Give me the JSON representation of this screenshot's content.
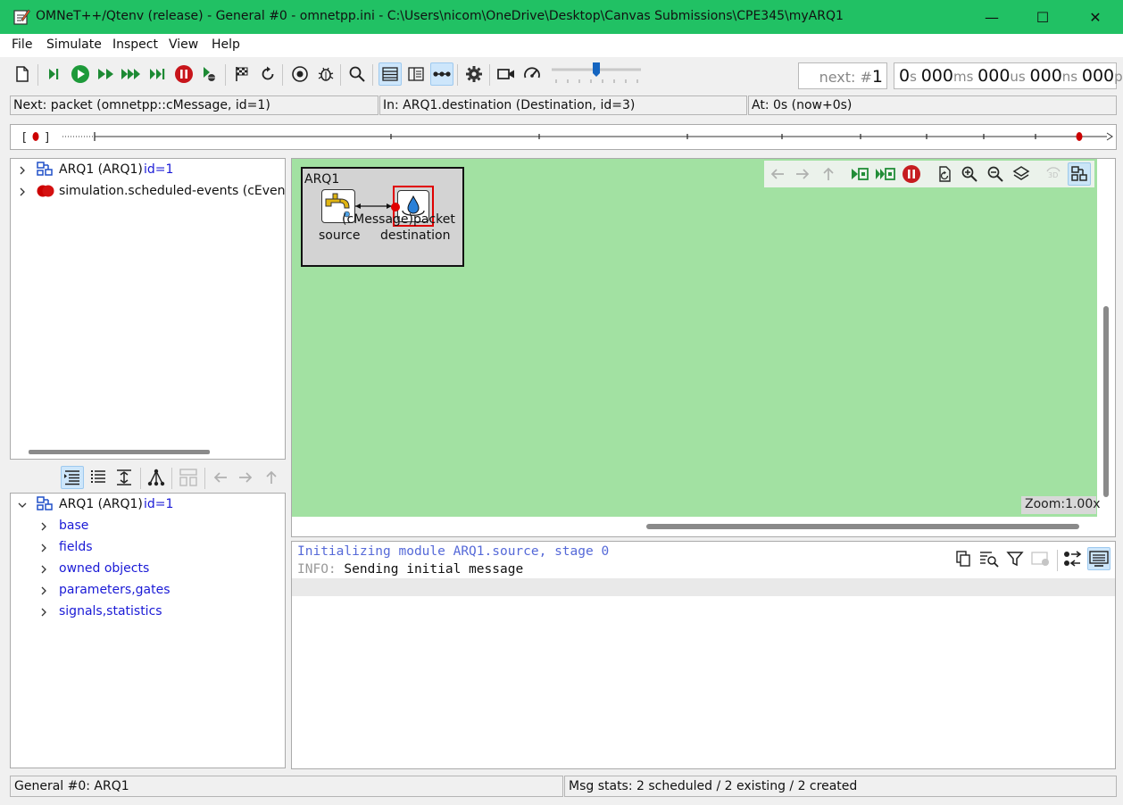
{
  "window": {
    "title": "OMNeT++/Qtenv (release) - General #0 - omnetpp.ini - C:\\Users\\nicom\\OneDrive\\Desktop\\Canvas Submissions\\CPE345\\myARQ1",
    "minimize": "—",
    "maximize": "☐",
    "close": "✕"
  },
  "menu": [
    "File",
    "Simulate",
    "Inspect",
    "View",
    "Help"
  ],
  "toolbar": {
    "icons": [
      "new-ini-icon",
      "step-icon",
      "run-icon",
      "fast-run-icon",
      "express-run-icon",
      "run-until-icon",
      "stop-icon",
      "debug-next-icon",
      "finish-icon",
      "rebuild-icon",
      "record-event-icon",
      "debug-icon",
      "find-icon",
      "timeline-toggle-icon",
      "layout-toggle-icon",
      "mode-toggle-icon",
      "settings-icon",
      "record-video-icon",
      "speed-icon"
    ],
    "next_prefix": "next: #",
    "next_value": "1",
    "time": {
      "s": "0",
      "ms": "000",
      "us": "000",
      "ns": "000",
      "ps": "000"
    },
    "speed_level": 0.5
  },
  "info": {
    "next": "Next: packet (omnetpp::cMessage, id=1)",
    "in": "In: ARQ1.destination (Destination, id=3)",
    "at": "At: 0s (now+0s)"
  },
  "timeline": {
    "bracket_left": "[",
    "bracket_right": "]"
  },
  "object_tree": {
    "rows": [
      {
        "name": "ARQ1 (ARQ1)",
        "id": "id=1"
      },
      {
        "name": "simulation.scheduled-events (cEventHe"
      }
    ]
  },
  "inspector": {
    "root": {
      "name": "ARQ1 (ARQ1)",
      "id": "id=1"
    },
    "children": [
      "base",
      "fields",
      "owned objects",
      "parameters,gates",
      "signals,statistics"
    ]
  },
  "network": {
    "module_title": "ARQ1",
    "source_label": "source",
    "destination_label": "destination",
    "message_label": "(cMessage)packet",
    "zoom": "Zoom:1.00x",
    "canvas_bg": "#a2e1a2"
  },
  "log": {
    "line1": "Initializing module ARQ1.source, stage 0",
    "line2_prefix": "INFO:",
    "line2_text": " Sending initial message"
  },
  "status": {
    "left": "General #0: ARQ1",
    "right": "Msg stats: 2 scheduled / 2 existing / 2 created"
  }
}
